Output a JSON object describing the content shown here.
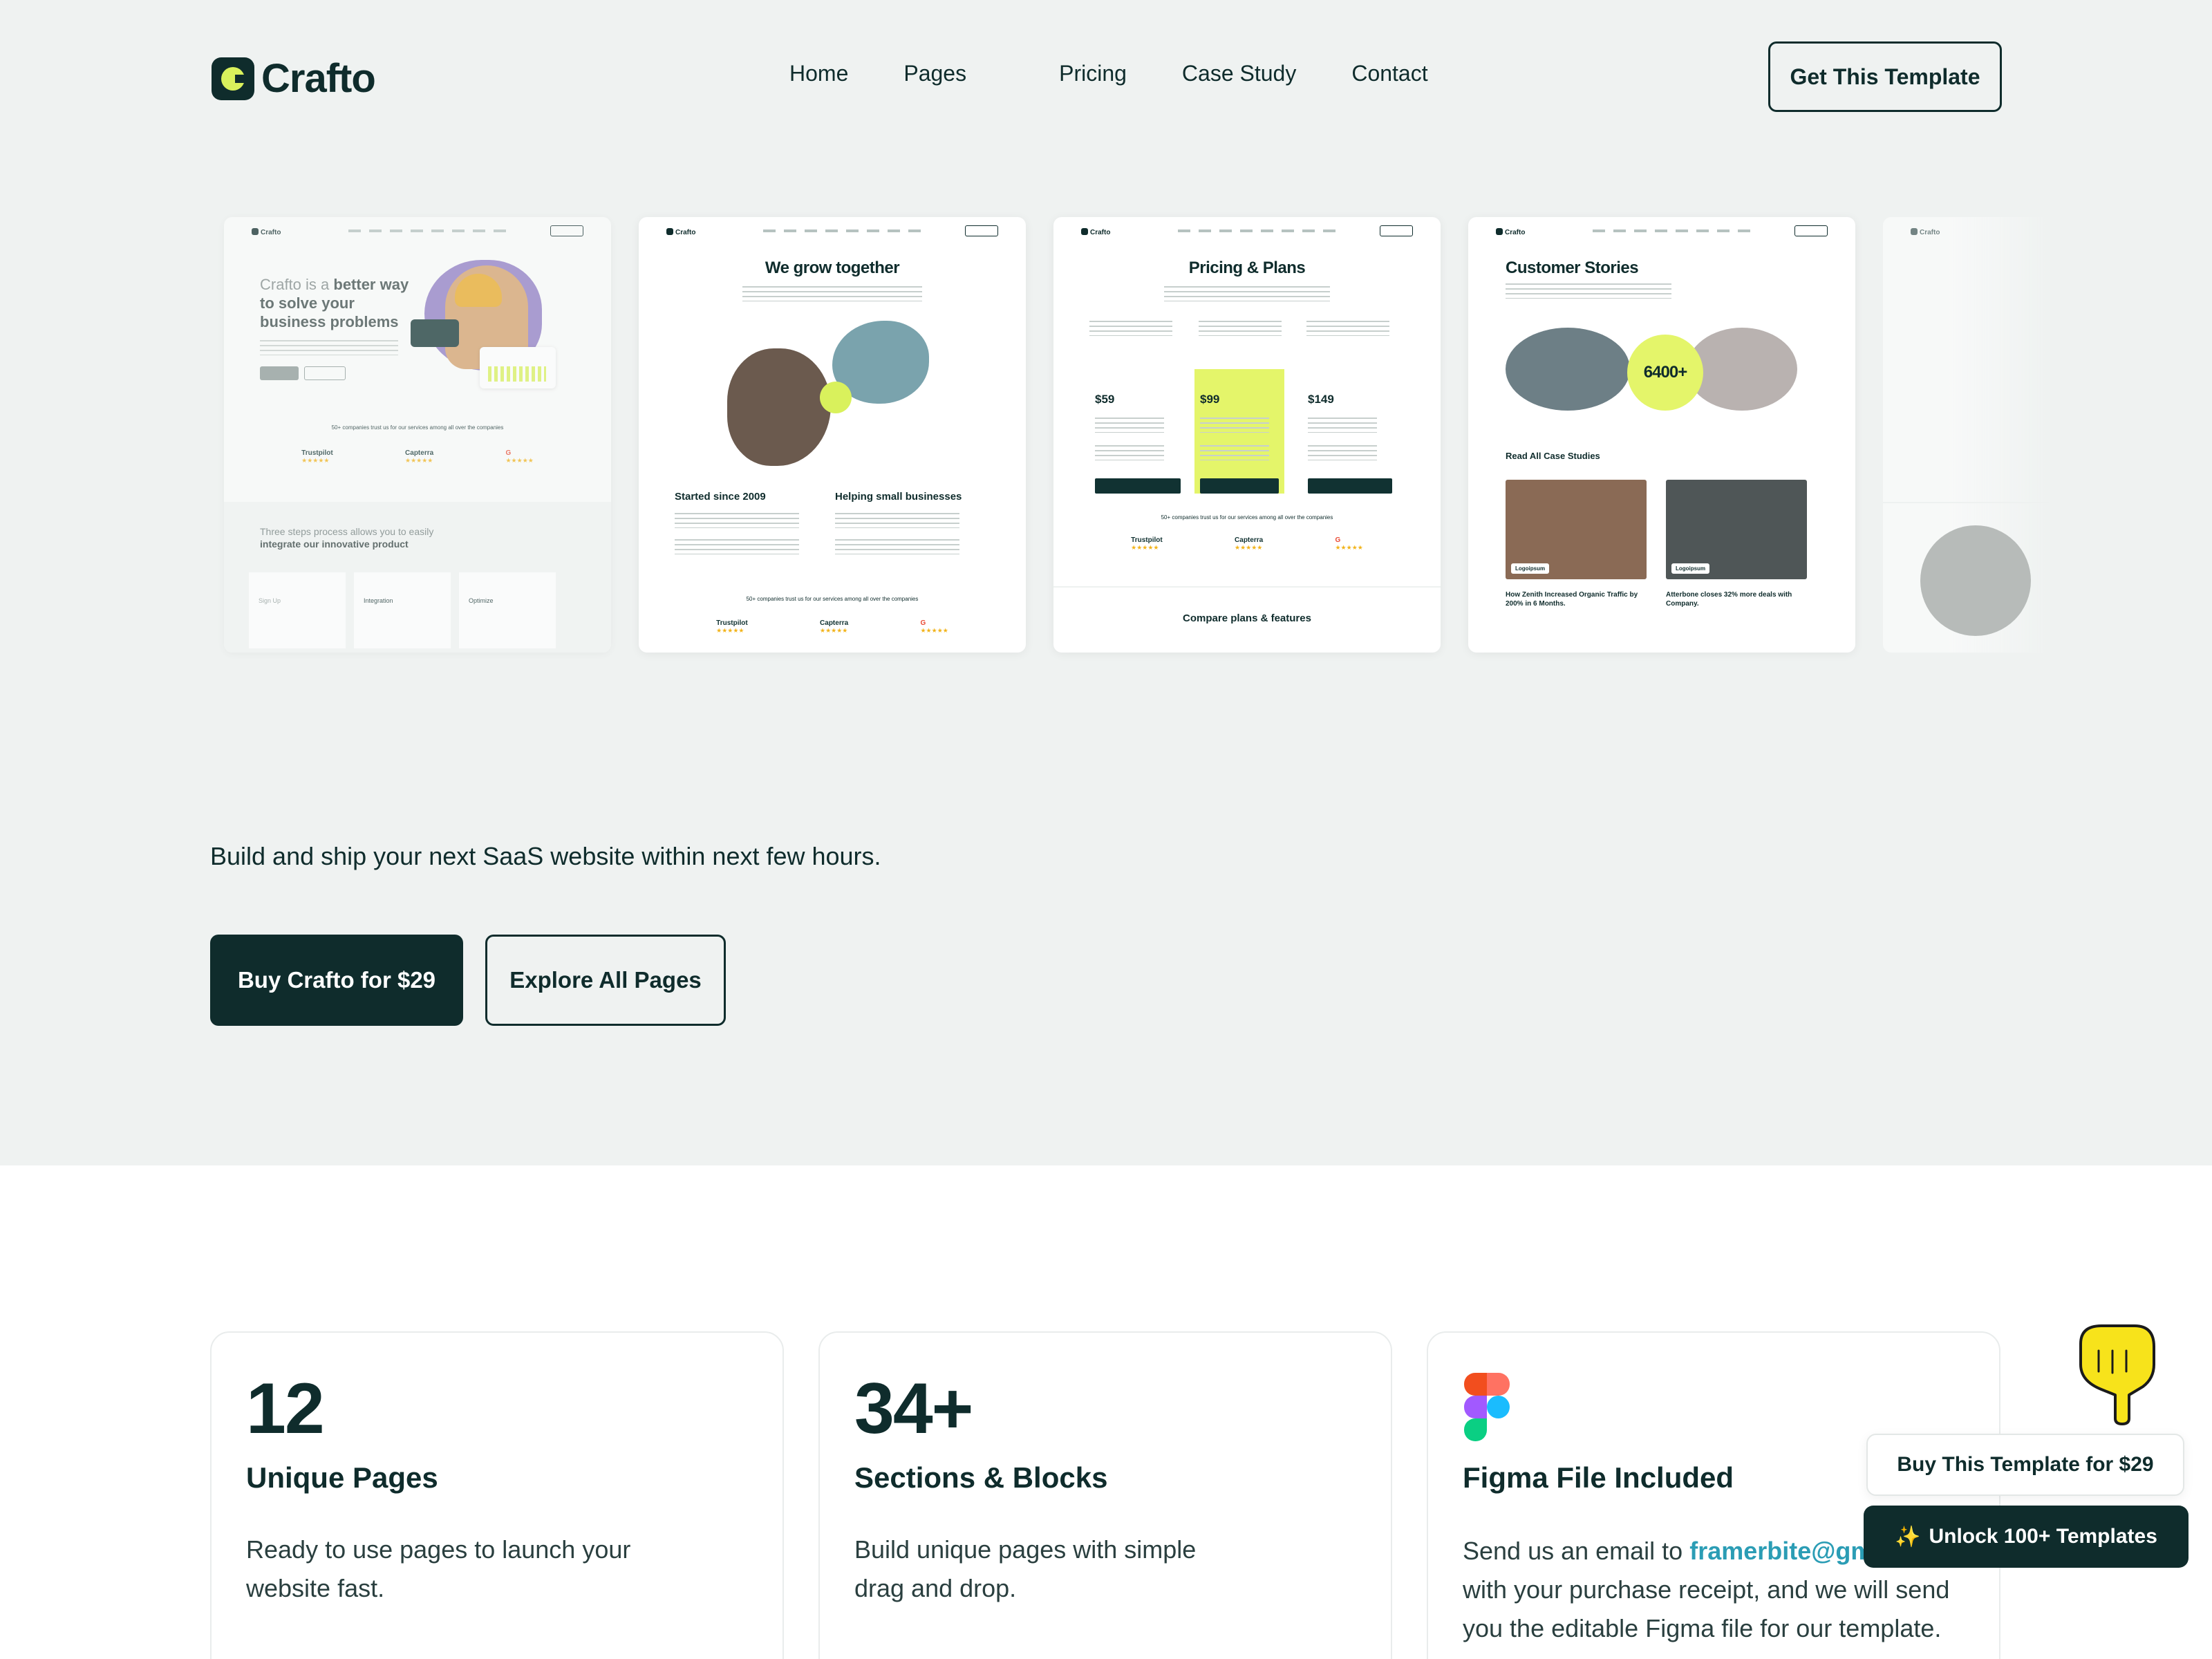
{
  "header": {
    "logo_text": "Crafto",
    "nav": [
      "Home",
      "Pages",
      "Pricing",
      "Case Study",
      "Contact"
    ],
    "cta_label": "Get This Template"
  },
  "previews": {
    "card1": {
      "headline_light": "Crafto is a ",
      "headline_bold": "better way to solve your business problems",
      "trusted": "50+ companies trust us for our services among all over the companies",
      "ratings": [
        "Trustpilot",
        "Capterra",
        "G"
      ],
      "lower_light": "Three steps process allows you to easily ",
      "lower_bold": "integrate our innovative product",
      "steps": [
        "Sign Up",
        "Integration",
        "Optimize"
      ]
    },
    "card2": {
      "title": "We grow together",
      "col1": "Started since 2009",
      "col2": "Helping small businesses",
      "trusted": "50+ companies trust us for our services among all over the companies",
      "ratings": [
        "Trustpilot",
        "Capterra",
        "G"
      ]
    },
    "card3": {
      "title": "Pricing & Plans",
      "prices": [
        "$59",
        "$99",
        "$149"
      ],
      "trusted": "50+ companies trust us for our services among all over the companies",
      "ratings": [
        "Trustpilot",
        "Capterra",
        "G"
      ],
      "compare": "Compare plans & features"
    },
    "card4": {
      "title": "Customer Stories",
      "badge": "6400+",
      "read_all": "Read All Case Studies",
      "logo_label": "Logoipsum",
      "case1": "How Zenith Increased Organic Traffic by 200% in 6 Months.",
      "case2": "Atterbone closes 32% more deals with Company."
    }
  },
  "hero": {
    "tagline": "Build and ship your next SaaS website within next few hours.",
    "buy_label": "Buy Crafto for $29",
    "explore_label": "Explore All Pages"
  },
  "features": [
    {
      "number": "12",
      "title": "Unique Pages",
      "desc": "Ready to use pages to launch your website fast."
    },
    {
      "number": "34+",
      "title": "Sections & Blocks",
      "desc": "Build unique pages with simple drag and drop."
    },
    {
      "title": "Figma File Included",
      "desc_before": "Send us an email to ",
      "email": "framerbite@gmail.com",
      "desc_after": " with your purchase receipt, and we will send you the editable Figma file for our template."
    }
  ],
  "floating": {
    "buy_label": "Buy This Template for $29",
    "unlock_icon": "✨",
    "unlock_label": "Unlock 100+ Templates"
  },
  "colors": {
    "primary": "#0f2c2c",
    "accent": "#d9f15c",
    "hero_bg": "#eff2f1",
    "email": "#2b9db5"
  }
}
